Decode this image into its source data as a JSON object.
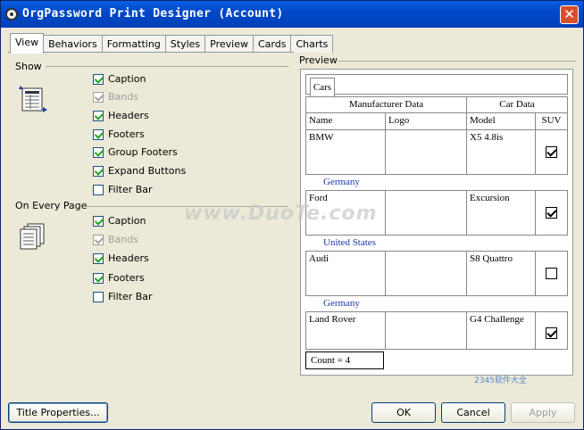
{
  "window": {
    "title": "OrgPassword Print Designer (Account)",
    "close_glyph": "✕"
  },
  "tabs": [
    {
      "label": "View",
      "active": true
    },
    {
      "label": "Behaviors"
    },
    {
      "label": "Formatting"
    },
    {
      "label": "Styles"
    },
    {
      "label": "Preview"
    },
    {
      "label": "Cards"
    },
    {
      "label": "Charts"
    }
  ],
  "show": {
    "label": "Show",
    "items": [
      {
        "label": "Caption",
        "checked": true,
        "enabled": true
      },
      {
        "label": "Bands",
        "checked": true,
        "enabled": false
      },
      {
        "label": "Headers",
        "checked": true,
        "enabled": true
      },
      {
        "label": "Footers",
        "checked": true,
        "enabled": true
      },
      {
        "label": "Group Footers",
        "checked": true,
        "enabled": true
      },
      {
        "label": "Expand Buttons",
        "checked": true,
        "enabled": true
      },
      {
        "label": "Filter Bar",
        "checked": false,
        "enabled": true
      }
    ]
  },
  "on_every_page": {
    "label": "On Every Page",
    "items": [
      {
        "label": "Caption",
        "checked": true,
        "enabled": true
      },
      {
        "label": "Bands",
        "checked": true,
        "enabled": false
      },
      {
        "label": "Headers",
        "checked": true,
        "enabled": true
      },
      {
        "label": "Footers",
        "checked": true,
        "enabled": true
      },
      {
        "label": "Filter Bar",
        "checked": false,
        "enabled": true
      }
    ]
  },
  "preview": {
    "label": "Preview",
    "tab": "Cars",
    "bands": {
      "left": "Manufacturer Data",
      "right": "Car Data"
    },
    "columns": {
      "name": "Name",
      "logo": "Logo",
      "model": "Model",
      "suv": "SUV"
    },
    "rows": [
      {
        "name": "BMW",
        "model": "X5 4.8is",
        "suv": true,
        "group": "Germany"
      },
      {
        "name": "Ford",
        "model": "Excursion",
        "suv": true,
        "group": "United States"
      },
      {
        "name": "Audi",
        "model": "S8 Quattro",
        "suv": false,
        "group": "Germany"
      },
      {
        "name": "Land Rover",
        "model": "G4 Challenge",
        "suv": true,
        "group": ""
      }
    ],
    "count": "Count = 4"
  },
  "buttons": {
    "title_properties": "Title Properties...",
    "ok": "OK",
    "cancel": "Cancel",
    "apply": "Apply"
  },
  "watermark": {
    "text": "www.DuoTe.com",
    "corner": "2345软件大全"
  }
}
